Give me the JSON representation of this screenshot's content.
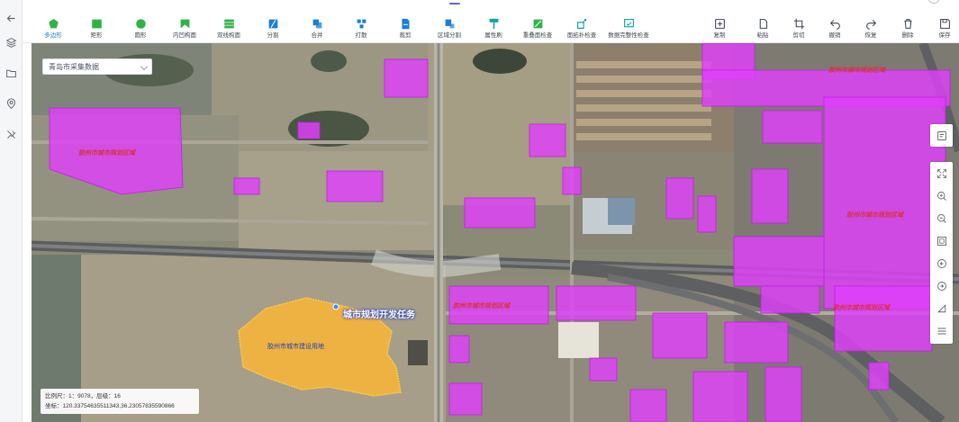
{
  "toolbar": {
    "left_tools": [
      {
        "name": "polygon",
        "label": "多边形",
        "active": true
      },
      {
        "name": "rectangle",
        "label": "矩形"
      },
      {
        "name": "circle",
        "label": "圆形"
      },
      {
        "name": "inward-polygon",
        "label": "内凹构面"
      },
      {
        "name": "dual-line-polygon",
        "label": "双线构面"
      },
      {
        "name": "split",
        "label": "分割"
      },
      {
        "name": "merge",
        "label": "合并"
      },
      {
        "name": "break",
        "label": "打散"
      },
      {
        "name": "trim",
        "label": "裁剪"
      },
      {
        "name": "area-split",
        "label": "区域分割"
      },
      {
        "name": "attribute-brush",
        "label": "属性刷"
      },
      {
        "name": "overlap-check",
        "label": "重叠面检查"
      },
      {
        "name": "topology-check",
        "label": "面拓扑检查"
      },
      {
        "name": "completeness-check",
        "label": "数据完整性检查"
      }
    ],
    "right_tools": [
      {
        "name": "copy",
        "label": "复制"
      },
      {
        "name": "paste",
        "label": "粘贴"
      },
      {
        "name": "cut",
        "label": "剪切"
      },
      {
        "name": "undo",
        "label": "撤销"
      },
      {
        "name": "redo",
        "label": "恢复"
      },
      {
        "name": "delete",
        "label": "删除"
      },
      {
        "name": "save",
        "label": "保存"
      }
    ]
  },
  "map": {
    "dataset_select": {
      "value": "青岛市采集数据"
    },
    "region_labels": [
      "胶州市城市规划区域",
      "胶州市城市规划区域",
      "胶州市城市规划区域",
      "胶州市城市规划区域",
      "胶州市城市规划区域"
    ],
    "yellow_label": "胶州市城市建设用地",
    "task_label": "城市规划开发任务",
    "scale_text": "比例尺：1：9078，层级：16",
    "coords_text": "坐标：120.33754635511343,36.23057835590866"
  },
  "colors": {
    "accent": "#1a7fd4",
    "planning_region": "#e040fb",
    "selection": "#f7b731"
  }
}
